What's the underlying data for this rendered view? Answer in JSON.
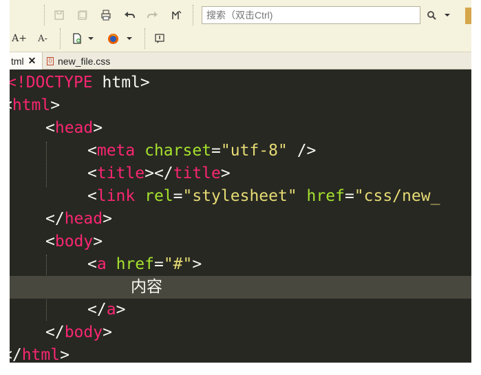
{
  "toolbar": {
    "icons": [
      "save-icon",
      "save-all-icon",
      "print-icon",
      "undo-icon",
      "redo-icon",
      "format-icon",
      "font-increase-icon",
      "font-decrease-icon",
      "new-file-icon",
      "firefox-icon",
      "info-icon",
      "search-icon",
      "dropdown-arrow-icon"
    ],
    "font_increase_label": "A+",
    "font_decrease_label": "A-",
    "search": {
      "placeholder": "搜索（双击Ctrl)"
    }
  },
  "tabs": [
    {
      "label": "tml",
      "active": true
    },
    {
      "label": "new_file.css",
      "active": false
    }
  ],
  "editor": {
    "colors": {
      "background": "#272822",
      "tag": "#f92672",
      "attribute": "#a6e22e",
      "string": "#e6db74",
      "text": "#f8f8f2",
      "current_line": "#49483e"
    },
    "lines": {
      "l1": {
        "lt": "<",
        "kw": "!DOCTYPE",
        "sp": " ",
        "txt": "html",
        "gt": ">"
      },
      "l2": {
        "lt": "<",
        "tag": "html",
        "gt": ">"
      },
      "l3": {
        "lt": "<",
        "tag": "head",
        "gt": ">"
      },
      "l4": {
        "lt": "<",
        "tag": "meta",
        "sp": " ",
        "attr": "charset",
        "eq": "=",
        "val": "\"utf-8\"",
        "end": " />"
      },
      "l5": {
        "lt": "<",
        "tag": "title",
        "mid": "></",
        "tag2": "title",
        "gt": ">"
      },
      "l6": {
        "lt": "<",
        "tag": "link",
        "sp": " ",
        "attr1": "rel",
        "eq1": "=",
        "val1": "\"stylesheet\"",
        "sp2": " ",
        "attr2": "href",
        "eq2": "=",
        "val2": "\"css/new_"
      },
      "l7": {
        "lt": "</",
        "tag": "head",
        "gt": ">"
      },
      "l8": {
        "lt": "<",
        "tag": "body",
        "gt": ">"
      },
      "l9": {
        "lt": "<",
        "tag": "a",
        "sp": " ",
        "attr": "href",
        "eq": "=",
        "val": "\"#\"",
        "gt": ">"
      },
      "l10": {
        "txt": "内容"
      },
      "l11": {
        "lt": "</",
        "tag": "a",
        "gt": ">"
      },
      "l12": {
        "lt": "</",
        "tag": "body",
        "gt": ">"
      },
      "l13": {
        "lt": "</",
        "tag": "html",
        "gt": ">"
      }
    }
  }
}
